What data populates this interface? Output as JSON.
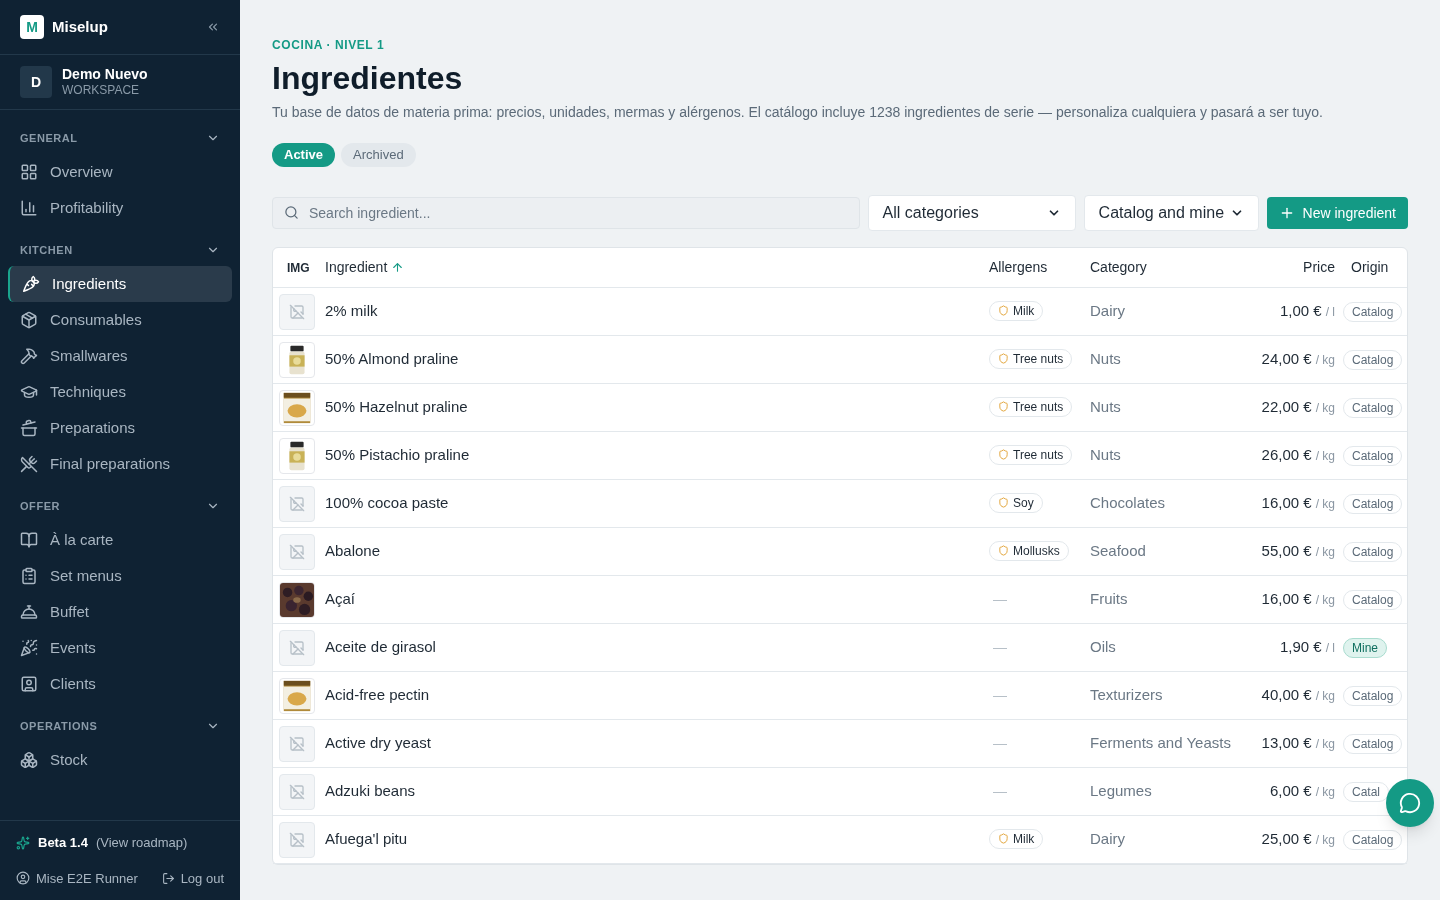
{
  "brand": {
    "logo_letter": "M",
    "name": "Miselup"
  },
  "workspace": {
    "initial": "D",
    "name": "Demo Nuevo",
    "label": "WORKSPACE"
  },
  "sidebar": {
    "sections": [
      {
        "title": "GENERAL",
        "expanded": true,
        "items": [
          {
            "label": "Overview",
            "selected": false
          },
          {
            "label": "Profitability",
            "selected": false
          }
        ]
      },
      {
        "title": "KITCHEN",
        "expanded": true,
        "items": [
          {
            "label": "Ingredients",
            "selected": true
          },
          {
            "label": "Consumables",
            "selected": false
          },
          {
            "label": "Smallwares",
            "selected": false
          },
          {
            "label": "Techniques",
            "selected": false
          },
          {
            "label": "Preparations",
            "selected": false
          },
          {
            "label": "Final preparations",
            "selected": false
          }
        ]
      },
      {
        "title": "OFFER",
        "expanded": true,
        "items": [
          {
            "label": "À la carte",
            "selected": false
          },
          {
            "label": "Set menus",
            "selected": false
          },
          {
            "label": "Buffet",
            "selected": false
          },
          {
            "label": "Events",
            "selected": false
          },
          {
            "label": "Clients",
            "selected": false
          }
        ]
      },
      {
        "title": "OPERATIONS",
        "expanded": true,
        "items": [
          {
            "label": "Stock",
            "selected": false
          }
        ]
      }
    ]
  },
  "footer": {
    "beta": "Beta 1.4",
    "roadmap": "(View roadmap)",
    "user": "Mise E2E Runner",
    "logout": "Log out"
  },
  "page": {
    "eyebrow": "COCINA · NIVEL 1",
    "title": "Ingredientes",
    "description": "Tu base de datos de materia prima: precios, unidades, mermas y alérgenos. El catálogo incluye 1238 ingredientes de serie — personaliza cualquiera y pasará a ser tuyo."
  },
  "tabs": [
    {
      "label": "Active",
      "selected": true
    },
    {
      "label": "Archived",
      "selected": false
    }
  ],
  "search": {
    "placeholder": "Search ingredient..."
  },
  "filters": [
    {
      "value": "All categories"
    },
    {
      "value": "Catalog and mine"
    }
  ],
  "new_button": "New ingredient",
  "table": {
    "columns": [
      "IMG",
      "Ingredient",
      "Allergens",
      "Category",
      "Price",
      "Origin"
    ],
    "rows": [
      {
        "kind": "none",
        "name": "2% milk",
        "allergen": "Milk",
        "category": "Dairy",
        "price": "1,00 €",
        "unit": "/ l",
        "origin": "Catalog"
      },
      {
        "name": "50% Almond praline",
        "allergen": "Tree nuts",
        "category": "Nuts",
        "price": "24,00 €",
        "unit": "/ kg",
        "origin": "Catalog"
      },
      {
        "name": "50% Hazelnut praline",
        "allergen": "Tree nuts",
        "category": "Nuts",
        "price": "22,00 €",
        "unit": "/ kg",
        "origin": "Catalog"
      },
      {
        "name": "50% Pistachio praline",
        "allergen": "Tree nuts",
        "category": "Nuts",
        "price": "26,00 €",
        "unit": "/ kg",
        "origin": "Catalog"
      },
      {
        "kind": "none",
        "name": "100% cocoa paste",
        "allergen": "Soy",
        "category": "Chocolates",
        "price": "16,00 €",
        "unit": "/ kg",
        "origin": "Catalog"
      },
      {
        "kind": "none",
        "name": "Abalone",
        "allergen": "Mollusks",
        "category": "Seafood",
        "price": "55,00 €",
        "unit": "/ kg",
        "origin": "Catalog"
      },
      {
        "name": "Açaí",
        "allergen": "—",
        "category": "Fruits",
        "price": "16,00 €",
        "unit": "/ kg",
        "origin": "Catalog"
      },
      {
        "kind": "none",
        "name": "Aceite de girasol",
        "allergen": "—",
        "category": "Oils",
        "price": "1,90 €",
        "unit": "/ l",
        "origin": "Mine"
      },
      {
        "name": "Acid-free pectin",
        "allergen": "—",
        "category": "Texturizers",
        "price": "40,00 €",
        "unit": "/ kg",
        "origin": "Catalog"
      },
      {
        "kind": "none",
        "name": "Active dry yeast",
        "allergen": "—",
        "category": "Ferments and Yeasts",
        "price": "13,00 €",
        "unit": "/ kg",
        "origin": "Catalog"
      },
      {
        "kind": "none",
        "name": "Adzuki beans",
        "allergen": "—",
        "category": "Legumes",
        "price": "6,00 €",
        "unit": "/ kg",
        "origin": "Catal"
      },
      {
        "kind": "none",
        "name": "Afuega'l pitu",
        "allergen": "Milk",
        "category": "Dairy",
        "price": "25,00 €",
        "unit": "/ kg",
        "origin": "Catalog"
      }
    ]
  }
}
